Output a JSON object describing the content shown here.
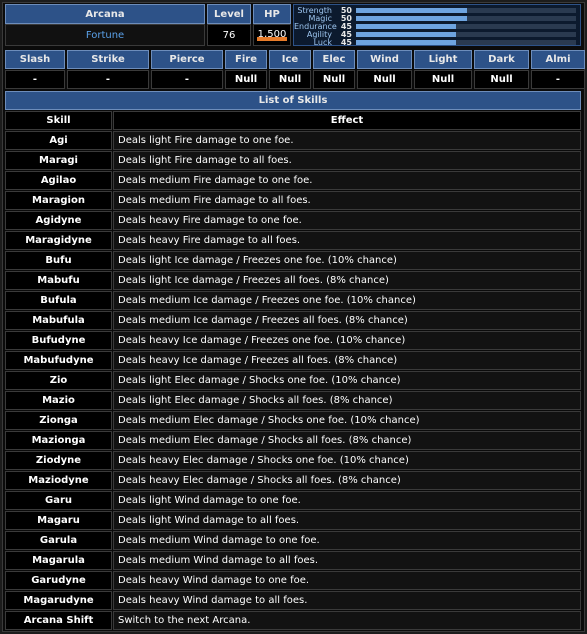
{
  "persona": {
    "arcana_label": "Arcana",
    "arcana_value": "Fortune",
    "level_label": "Level",
    "level_value": "76",
    "hp_label": "HP",
    "hp_value": "1,500",
    "hp_fill": 1.0
  },
  "stats": [
    {
      "name": "Strength",
      "value": "50",
      "level": 50
    },
    {
      "name": "Magic",
      "value": "50",
      "level": 50
    },
    {
      "name": "Endurance",
      "value": "45",
      "level": 45
    },
    {
      "name": "Agility",
      "value": "45",
      "level": 45
    },
    {
      "name": "Luck",
      "value": "45",
      "level": 45
    }
  ],
  "affinities": {
    "headers": [
      "Slash",
      "Strike",
      "Pierce",
      "Fire",
      "Ice",
      "Elec",
      "Wind",
      "Light",
      "Dark",
      "Almi"
    ],
    "values": [
      "-",
      "-",
      "-",
      "Null",
      "Null",
      "Null",
      "Null",
      "Null",
      "Null",
      "-"
    ]
  },
  "skills_table": {
    "title": "List of Skills",
    "col_skill": "Skill",
    "col_effect": "Effect",
    "rows": [
      {
        "skill": "Agi",
        "effect": "Deals light Fire damage to one foe."
      },
      {
        "skill": "Maragi",
        "effect": "Deals light Fire damage to all foes."
      },
      {
        "skill": "Agilao",
        "effect": "Deals medium Fire damage to one foe."
      },
      {
        "skill": "Maragion",
        "effect": "Deals medium Fire damage to all foes."
      },
      {
        "skill": "Agidyne",
        "effect": "Deals heavy Fire damage to one foe."
      },
      {
        "skill": "Maragidyne",
        "effect": "Deals heavy Fire damage to all foes."
      },
      {
        "skill": "Bufu",
        "effect": "Deals light Ice damage / Freezes one foe. (10% chance)"
      },
      {
        "skill": "Mabufu",
        "effect": "Deals light Ice damage / Freezes all foes. (8% chance)"
      },
      {
        "skill": "Bufula",
        "effect": "Deals medium Ice damage / Freezes one foe. (10% chance)"
      },
      {
        "skill": "Mabufula",
        "effect": "Deals medium Ice damage / Freezes all foes. (8% chance)"
      },
      {
        "skill": "Bufudyne",
        "effect": "Deals heavy Ice damage / Freezes one foe. (10% chance)"
      },
      {
        "skill": "Mabufudyne",
        "effect": "Deals heavy Ice damage / Freezes all foes. (8% chance)"
      },
      {
        "skill": "Zio",
        "effect": "Deals light Elec damage / Shocks one foe. (10% chance)"
      },
      {
        "skill": "Mazio",
        "effect": "Deals light Elec damage / Shocks all foes. (8% chance)"
      },
      {
        "skill": "Zionga",
        "effect": "Deals medium Elec damage / Shocks one foe. (10% chance)"
      },
      {
        "skill": "Mazionga",
        "effect": "Deals medium Elec damage / Shocks all foes. (8% chance)"
      },
      {
        "skill": "Ziodyne",
        "effect": "Deals heavy Elec damage / Shocks one foe. (10% chance)"
      },
      {
        "skill": "Maziodyne",
        "effect": "Deals heavy Elec damage / Shocks all foes. (8% chance)"
      },
      {
        "skill": "Garu",
        "effect": "Deals light Wind damage to one foe."
      },
      {
        "skill": "Magaru",
        "effect": "Deals light Wind damage to all foes."
      },
      {
        "skill": "Garula",
        "effect": "Deals medium Wind damage to one foe."
      },
      {
        "skill": "Magarula",
        "effect": "Deals medium Wind damage to all foes."
      },
      {
        "skill": "Garudyne",
        "effect": "Deals heavy Wind damage to one foe."
      },
      {
        "skill": "Magarudyne",
        "effect": "Deals heavy Wind damage to all foes."
      },
      {
        "skill": "Arcana Shift",
        "effect": "Switch to the next Arcana."
      }
    ]
  }
}
